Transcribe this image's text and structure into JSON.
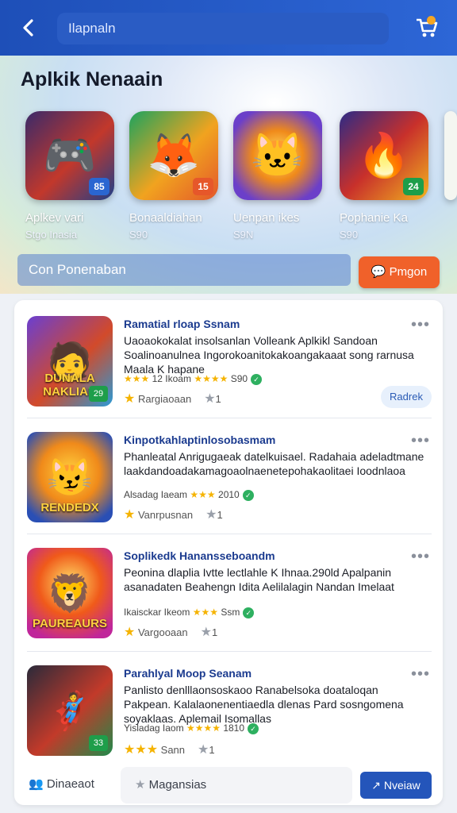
{
  "header": {
    "search_text": "Ilapnaln",
    "icons": {
      "back": "back-chevron-icon",
      "cart": "cart-icon"
    }
  },
  "hero": {
    "title": "Aplkik Nenaain",
    "apps": [
      {
        "name": "Aplkev vari",
        "meta": "Stgo Inasia",
        "badge": "85"
      },
      {
        "name": "Bonaaldiahan",
        "meta": "S90",
        "badge": "15"
      },
      {
        "name": "Uenpan ikes",
        "meta": "S9N",
        "badge": ""
      },
      {
        "name": "Pophanie Ka",
        "meta": "S90",
        "badge": "24"
      }
    ],
    "subtitle": "Con Ponenaban",
    "action_label": "Pmgon"
  },
  "list": [
    {
      "title": "Ramatial rloap Ssnam",
      "desc": "Uaoaokokalat insolsanlan Volleank Aplkikl Sandoan Soalinoanulnea Ingorokoanitokakoangakaaat song rarnusa Maala K hapane",
      "rating": "12 Ikoam",
      "rating_count": "S90",
      "footer": "Rargiaoaan",
      "footer_count": "1",
      "thumb_caption": "DUNALA NAKLIAK",
      "thumb_badge": "29",
      "chip": "Radrek"
    },
    {
      "title": "Kinpotkahlaptinlosobasmam",
      "desc": "Phanleatal Anrigugaeak datelkuisael. Radahaia adeladtmane laakdandoadakamagoaolnaenetepohakaolitaei Ioodnlaoa",
      "rating": "Alsadag Iaeam",
      "rating_count": "2010",
      "footer": "Vanrpusnan",
      "footer_count": "1",
      "thumb_caption": "RENDEDX",
      "thumb_badge": "",
      "chip": ""
    },
    {
      "title": "Soplikedk Hanansseboandm",
      "desc": "Peonina dlaplia Ivtte lectlahle K Ihnaa.290ld Apalpanin asanadaten Beahengn Idita Aelilalagin Nandan Imelaat",
      "rating": "Ikaisckar Ikeom",
      "rating_count": "Ssm",
      "footer": "Vargooaan",
      "footer_count": "1",
      "thumb_caption": "PAUREAURS",
      "thumb_badge": "",
      "chip": ""
    },
    {
      "title": "Parahlyal Moop Seanam",
      "desc": "Panlisto denlllaonsoskaoo Ranabelsoka doataloqan Pakpean. Kalalaonenentiaedla dlenas Pard sosngomena soyaklaas. Aplemail Isomallas",
      "rating": "Yisladag Iaom",
      "rating_count": "1810",
      "footer": "Sann",
      "footer_count": "1",
      "thumb_caption": "",
      "thumb_badge": "33",
      "chip": ""
    }
  ],
  "bottom": {
    "left_label": "Dinaeaot",
    "mid_label": "Magansias",
    "button_label": "Nveiaw"
  },
  "colors": {
    "primary": "#2455ba",
    "accent_orange": "#f0612a",
    "star": "#f5b300",
    "green": "#2eb060"
  }
}
